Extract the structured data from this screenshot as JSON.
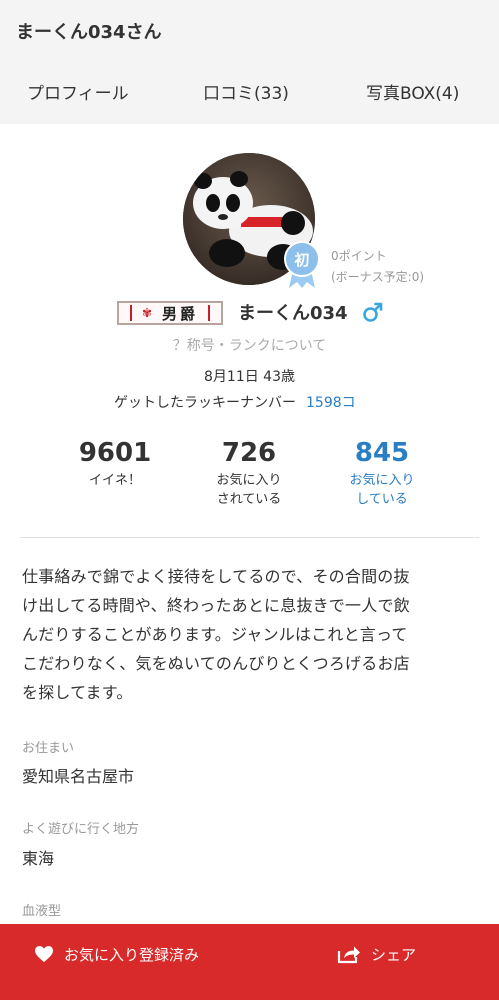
{
  "header": {
    "title": "まーくん034さん"
  },
  "tabs": [
    {
      "label": "プロフィール",
      "active": true
    },
    {
      "label": "口コミ(33)"
    },
    {
      "label": "写真BOX(4)"
    }
  ],
  "profile": {
    "avatar_icon": "panda-figure-avatar",
    "badge_label": "初",
    "points_line1": "0ポイント",
    "points_line2": "(ボーナス予定:0)",
    "rank_title": "男爵",
    "username": "まーくん034",
    "gender_icon": "male-icon",
    "rank_link": "？称号・ランクについて",
    "birth_age": "8月11日 43歳",
    "lucky_label": "ゲットしたラッキーナンバー",
    "lucky_number": "1598コ"
  },
  "stats": [
    {
      "value": "9601",
      "label1": "イイネ！",
      "label2": ""
    },
    {
      "value": "726",
      "label1": "お気に入り",
      "label2": "されている"
    },
    {
      "value": "845",
      "label1": "お気に入り",
      "label2": "している"
    }
  ],
  "intro_lines": [
    "仕事絡みで錦でよく接待をしてるので、その合間の抜",
    "け出してる時間や、終わったあとに息抜きで一人で飲",
    "んだりすることがあります。ジャンルはこれと言って",
    "こだわりなく、気をぬいてのんびりとくつろげるお店",
    "を探してます。"
  ],
  "fields": {
    "residence_label": "お住まい",
    "residence_value": "愛知県名古屋市",
    "area_label": "よく遊びに行く地方",
    "area_value": "東海",
    "blood_label": "血液型"
  },
  "bottom_bar": {
    "favorite_label": "お気に入り登録済み",
    "share_label": "シェア"
  },
  "colors": {
    "accent": "#d82a2a",
    "link": "#2a7ec4"
  }
}
